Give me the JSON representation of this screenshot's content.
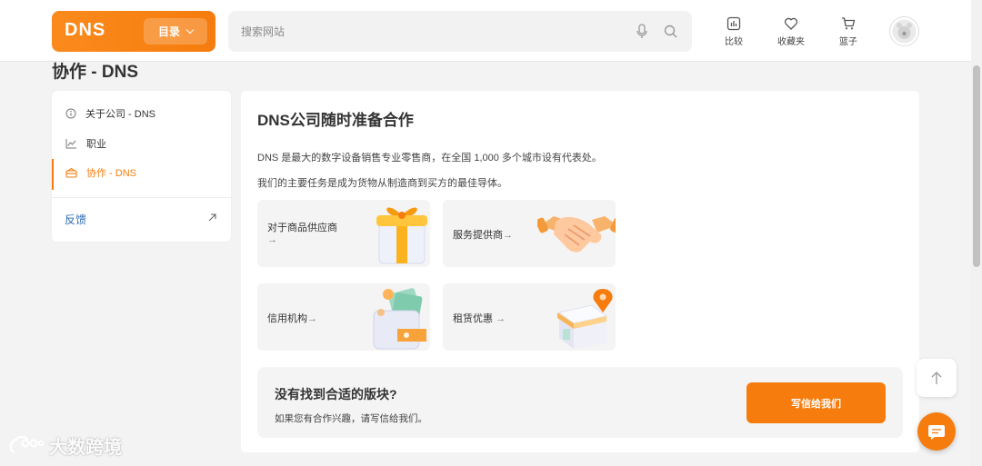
{
  "header": {
    "logo": "DNS",
    "catalog_label": "目录",
    "search_placeholder": "搜索网站",
    "actions": [
      {
        "label": "比较",
        "icon": "compare-chart-icon"
      },
      {
        "label": "收藏夹",
        "icon": "heart-icon"
      },
      {
        "label": "篮子",
        "icon": "cart-icon"
      }
    ],
    "avatar_icon": "user-avatar-icon"
  },
  "page": {
    "title": "协作 - DNS"
  },
  "sidebar": {
    "items": [
      {
        "label": "关于公司 - DNS",
        "icon": "info-icon",
        "active": false
      },
      {
        "label": "职业",
        "icon": "trend-icon",
        "active": false
      },
      {
        "label": "协作 - DNS",
        "icon": "handshake-box-icon",
        "active": true
      }
    ],
    "feedback_label": "反馈",
    "feedback_icon": "arrow-up-right-icon"
  },
  "main": {
    "title": "DNS公司随时准备合作",
    "paragraph_1": "DNS 是最大的数字设备销售专业零售商，在全国 1,000 多个城市设有代表处。",
    "paragraph_2": "我们的主要任务是成为货物从制造商到买方的最佳导体。",
    "tiles": [
      {
        "label": "对于商品供应商",
        "arrow": "→",
        "icon": "gift-box-icon"
      },
      {
        "label": "服务提供商",
        "arrow": "→",
        "icon": "handshake-icon"
      },
      {
        "label": "信用机构",
        "arrow": "→",
        "icon": "wallet-money-icon"
      },
      {
        "label": "租赁优惠",
        "arrow": "→",
        "icon": "shop-location-icon"
      }
    ],
    "cta": {
      "title": "没有找到合适的版块?",
      "subtitle": "如果您有合作兴趣，请写信给我们。",
      "button_label": "写信给我们"
    }
  },
  "floating": {
    "to_top_icon": "arrow-up-icon",
    "chat_icon": "chat-bubble-icon"
  },
  "watermark": {
    "text": "大数跨境"
  },
  "colors": {
    "accent": "#f57c0d",
    "link": "#2b6cb0",
    "background": "#f3f3f3"
  }
}
